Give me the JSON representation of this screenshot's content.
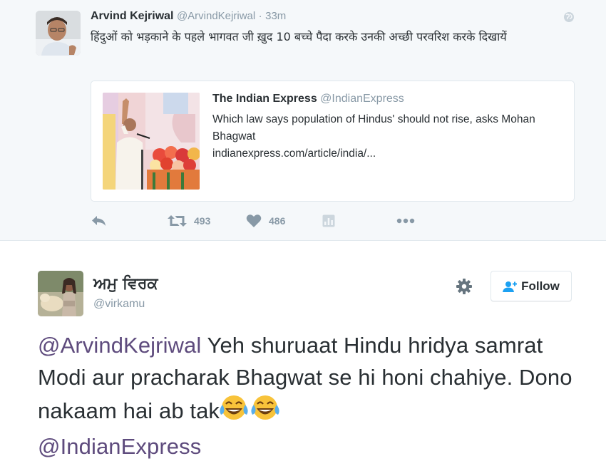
{
  "top_tweet": {
    "name": "Arvind Kejriwal",
    "handle": "@ArvindKejriwal",
    "separator": "·",
    "time": "33m",
    "text": "हिंदुओं को भड़काने के पहले भागवत जी ख़ुद 10 बच्चे पैदा करके उनकी अच्छी परवरिश करके दिखायें",
    "card": {
      "source_name": "The Indian Express",
      "source_handle": "@IndianExpress",
      "description": "Which law says population of Hindus' should not rise, asks Mohan Bhagwat",
      "url": "indianexpress.com/article/india/..."
    },
    "actions": {
      "reply_icon": "reply-icon",
      "retweet_icon": "retweet-icon",
      "retweet_count": "493",
      "like_icon": "heart-icon",
      "like_count": "486",
      "analytics_icon": "analytics-icon",
      "more_icon": "more-dots-icon"
    }
  },
  "reply_tweet": {
    "name": "ਅਮੁ ਵਿਰਕ",
    "handle": "@virkamu",
    "follow_label": "Follow",
    "text_parts": {
      "mention1": "@ArvindKejriwal",
      "body": " Yeh shuruaat Hindu hridya samrat Modi aur pracharak Bhagwat se hi honi chahiye. Dono nakaam hai ab tak",
      "mention2": "@IndianExpress"
    },
    "emoji": "face-with-tears-of-joy-icon"
  },
  "colors": {
    "top_background": "#f5f8fa",
    "muted": "#8899a6",
    "mention": "#5e4b7d",
    "text": "#292f33"
  }
}
